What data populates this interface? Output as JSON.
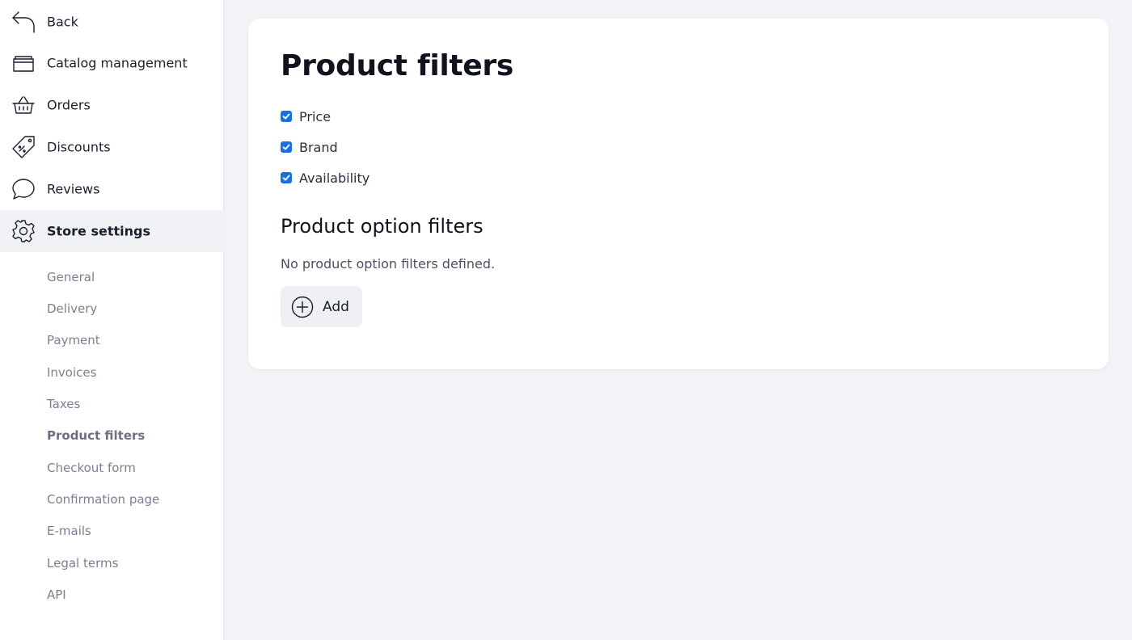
{
  "sidebar": {
    "back": {
      "label": "Back",
      "icon": "back-arrow-icon"
    },
    "items": [
      {
        "label": "Catalog management",
        "icon": "folder-icon"
      },
      {
        "label": "Orders",
        "icon": "basket-icon"
      },
      {
        "label": "Discounts",
        "icon": "price-tag-icon"
      },
      {
        "label": "Reviews",
        "icon": "speech-bubble-icon"
      },
      {
        "label": "Store settings",
        "icon": "gear-icon",
        "active": true
      }
    ],
    "subitems": [
      {
        "label": "General"
      },
      {
        "label": "Delivery"
      },
      {
        "label": "Payment"
      },
      {
        "label": "Invoices"
      },
      {
        "label": "Taxes"
      },
      {
        "label": "Product filters",
        "active": true
      },
      {
        "label": "Checkout form"
      },
      {
        "label": "Confirmation page"
      },
      {
        "label": "E-mails"
      },
      {
        "label": "Legal terms"
      },
      {
        "label": "API"
      }
    ]
  },
  "main": {
    "title": "Product filters",
    "filters": [
      {
        "label": "Price",
        "checked": true
      },
      {
        "label": "Brand",
        "checked": true
      },
      {
        "label": "Availability",
        "checked": true
      }
    ],
    "option_filters": {
      "title": "Product option filters",
      "empty_text": "No product option filters defined.",
      "add_label": "Add",
      "add_icon": "plus-circle-icon"
    }
  },
  "colors": {
    "checkbox_accent": "#1a6fe0",
    "sidebar_active_bg": "#f1f2f5",
    "page_bg": "#f2f3f6"
  }
}
